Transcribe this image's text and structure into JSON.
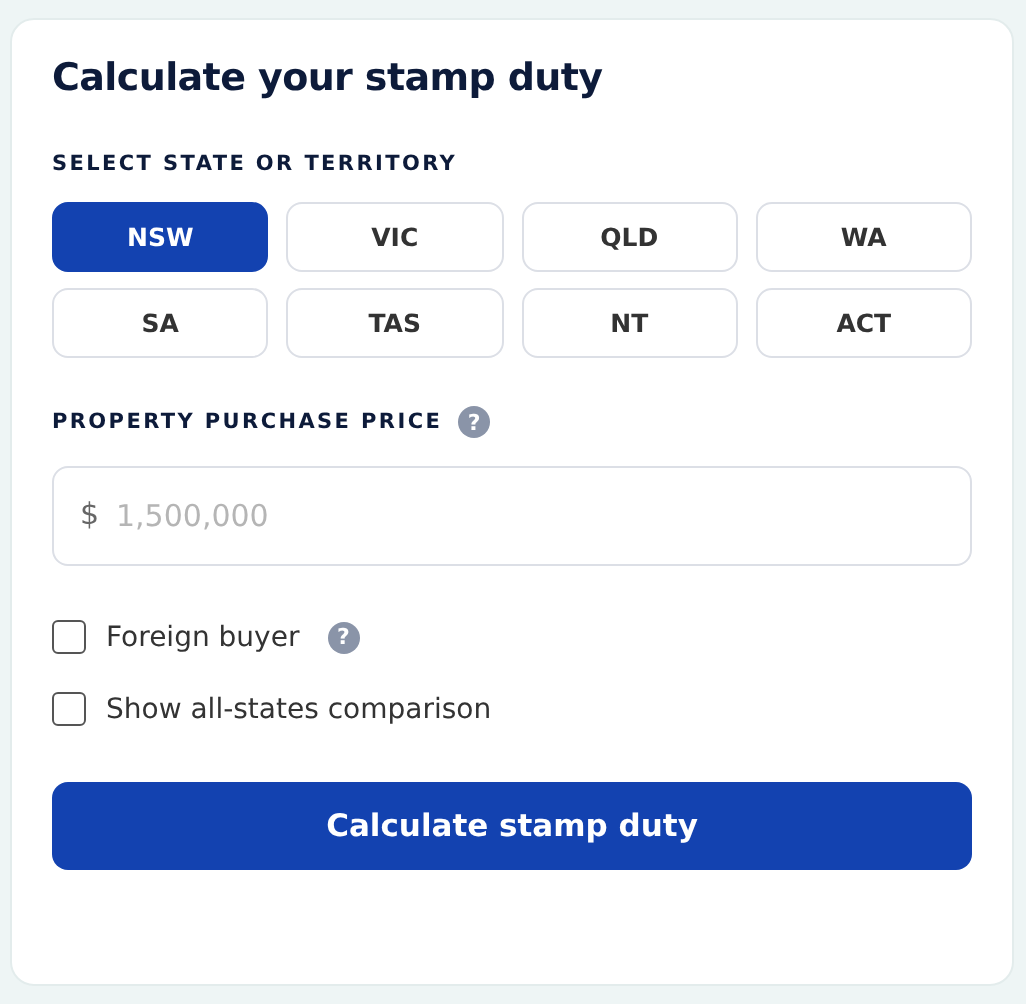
{
  "title": "Calculate your stamp duty",
  "state_label": "SELECT STATE OR TERRITORY",
  "states": [
    {
      "label": "NSW",
      "selected": true
    },
    {
      "label": "VIC",
      "selected": false
    },
    {
      "label": "QLD",
      "selected": false
    },
    {
      "label": "WA",
      "selected": false
    },
    {
      "label": "SA",
      "selected": false
    },
    {
      "label": "TAS",
      "selected": false
    },
    {
      "label": "NT",
      "selected": false
    },
    {
      "label": "ACT",
      "selected": false
    }
  ],
  "price": {
    "label": "PROPERTY PURCHASE PRICE",
    "help": "?",
    "prefix": "$",
    "placeholder": "1,500,000"
  },
  "options": [
    {
      "label": "Foreign buyer",
      "checked": false,
      "help": "?"
    },
    {
      "label": "Show all-states comparison",
      "checked": false
    }
  ],
  "submit": "Calculate stamp duty"
}
